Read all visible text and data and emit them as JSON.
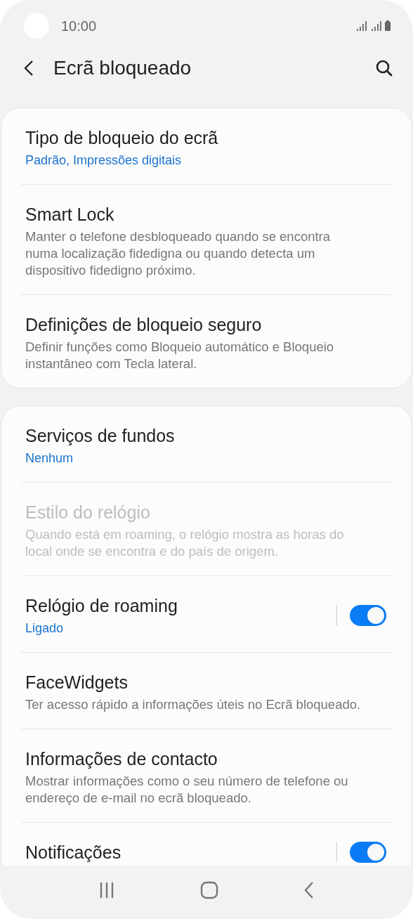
{
  "status_bar": {
    "time": "10:00"
  },
  "header": {
    "title": "Ecrã bloqueado"
  },
  "sections": [
    {
      "items": [
        {
          "kind": "link",
          "title": "Tipo de bloqueio do ecrã",
          "value": "Padrão, Impressões digitais",
          "disabled": false
        },
        {
          "kind": "link",
          "title": "Smart Lock",
          "description": "Manter o telefone desbloqueado quando se encontra numa localização fidedigna ou quando detecta um dispositivo fidedigno próximo.",
          "disabled": false
        },
        {
          "kind": "link",
          "title": "Definições de bloqueio seguro",
          "description": "Definir funções como Bloqueio automático e Bloqueio instantâneo com Tecla lateral.",
          "disabled": false
        }
      ]
    },
    {
      "items": [
        {
          "kind": "link",
          "title": "Serviços de fundos",
          "value": "Nenhum",
          "disabled": false
        },
        {
          "kind": "link",
          "title": "Estilo do relógio",
          "description": "Quando está em roaming, o relógio mostra as horas do local onde se encontra e do país de origem.",
          "disabled": true
        },
        {
          "kind": "toggle",
          "title": "Relógio de roaming",
          "value": "Ligado",
          "disabled": false,
          "on": true
        },
        {
          "kind": "link",
          "title": "FaceWidgets",
          "description": "Ter acesso rápido a informações úteis no Ecrã bloqueado.",
          "disabled": false
        },
        {
          "kind": "link",
          "title": "Informações de contacto",
          "description": "Mostrar informações como o seu número de telefone ou endereço de e-mail no ecrã bloqueado.",
          "disabled": false
        },
        {
          "kind": "toggle",
          "title": "Notificações",
          "disabled": false,
          "on": true
        }
      ]
    }
  ]
}
